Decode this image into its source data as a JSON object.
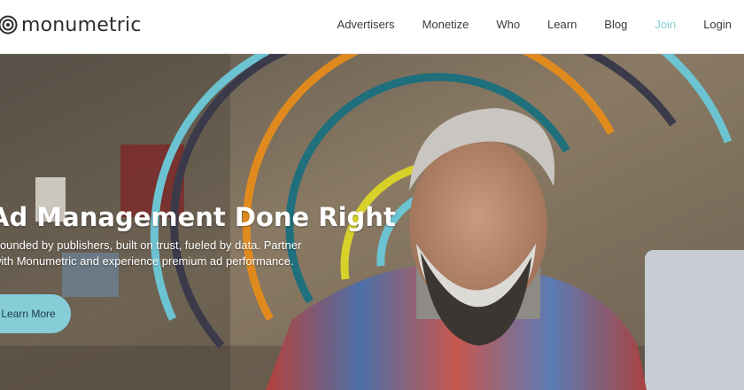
{
  "brand": {
    "name": "monumetric",
    "accent_color": "#88cfd9"
  },
  "nav": {
    "items": [
      {
        "label": "Advertisers"
      },
      {
        "label": "Monetize"
      },
      {
        "label": "Who"
      },
      {
        "label": "Learn"
      },
      {
        "label": "Blog"
      },
      {
        "label": "Join"
      },
      {
        "label": "Login"
      }
    ]
  },
  "hero": {
    "headline": "Ad Management Done Right",
    "subtext": "Founded by publishers, built on trust, fueled by data. Partner with Monumetric and experience premium ad performance.",
    "cta_label": "Learn More",
    "ring_colors": [
      "#6cc3d1",
      "#3a3a4a",
      "#e08a1e",
      "#1f6f7c",
      "#d8d12a"
    ]
  }
}
